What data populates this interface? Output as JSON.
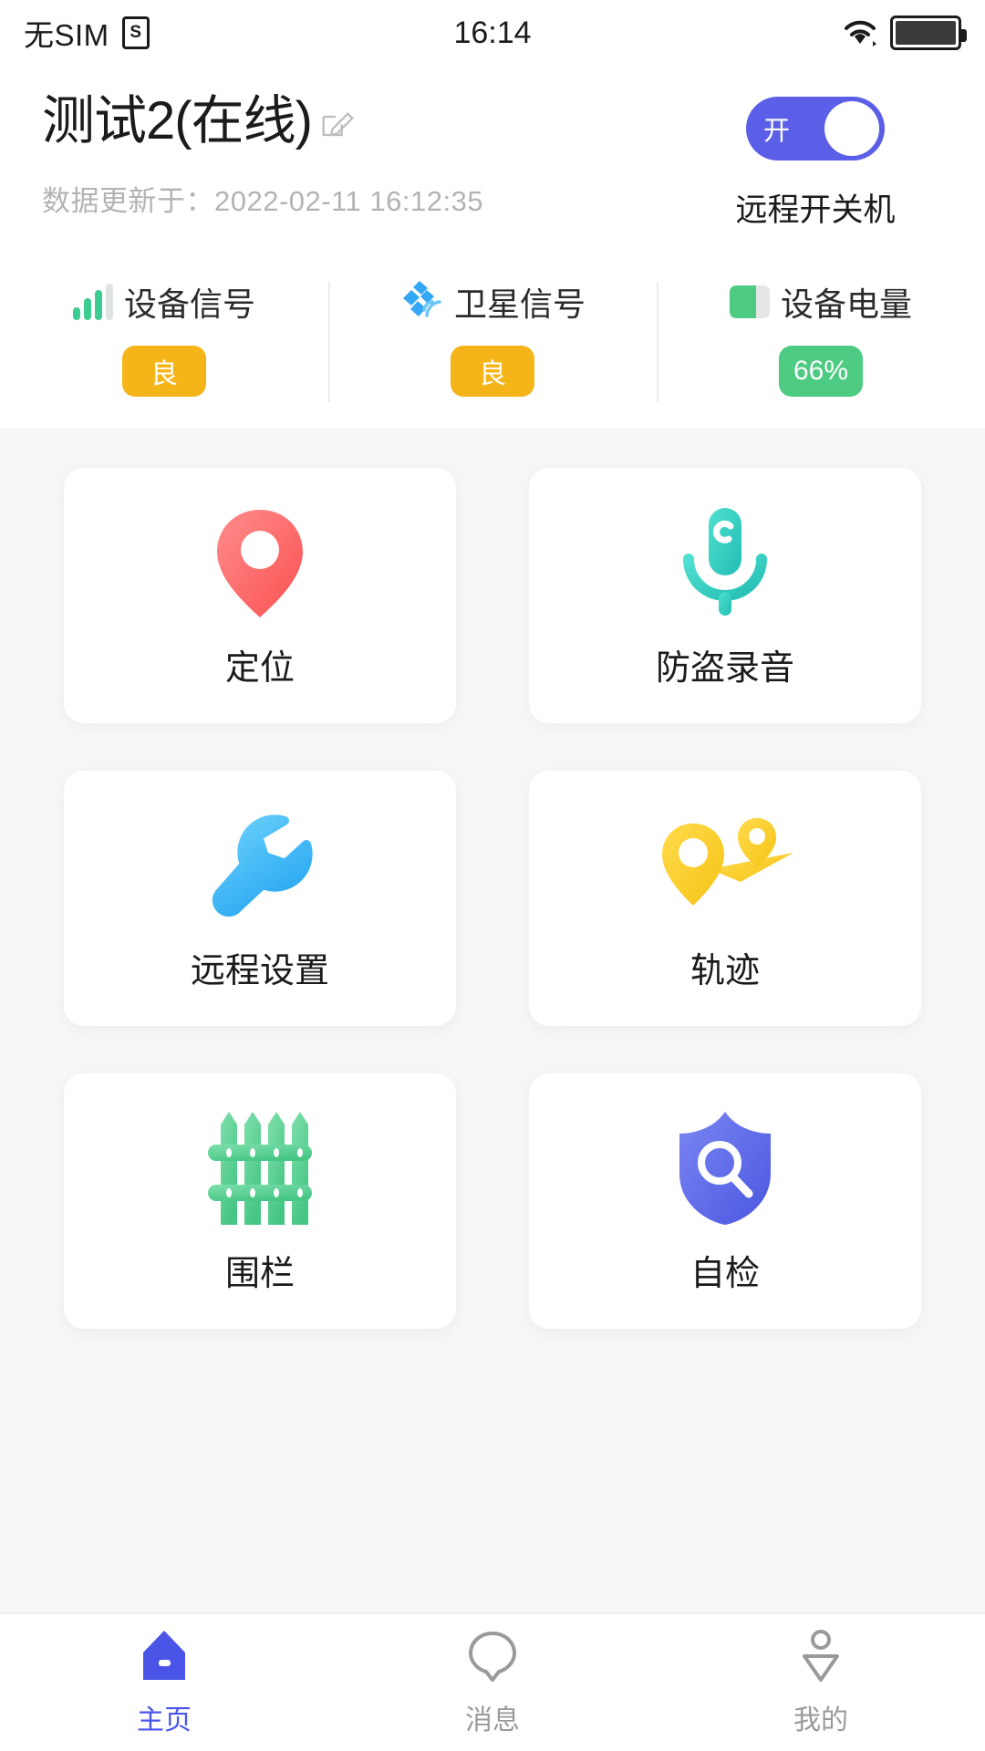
{
  "status_bar": {
    "carrier": "无SIM",
    "sim_icon": "sim-card-icon",
    "time": "16:14",
    "wifi_icon": "wifi-icon",
    "battery_icon": "battery-full-icon"
  },
  "header": {
    "device_name": "测试2(在线)",
    "edit_icon": "edit-pencil-icon",
    "updated_label": "数据更新于：",
    "updated_time": "2022-02-11 16:12:35",
    "power_switch": {
      "state_label": "开",
      "caption": "远程开关机",
      "on": true,
      "on_color": "#5b5fe8"
    }
  },
  "metrics": [
    {
      "icon": "signal-bars-icon",
      "label": "设备信号",
      "value": "良",
      "badge_color": "#f5b519",
      "icon_color": "#3ccb91"
    },
    {
      "icon": "satellite-icon",
      "label": "卫星信号",
      "value": "良",
      "badge_color": "#f5b519",
      "icon_color": "#35a8f5"
    },
    {
      "icon": "battery-icon",
      "label": "设备电量",
      "value": "66%",
      "badge_color": "#4dcb82",
      "icon_color": "#4dcb82",
      "battery_percent": 66
    }
  ],
  "features": [
    {
      "icon": "map-pin-icon",
      "label": "定位",
      "color": "#fb6b6b"
    },
    {
      "icon": "microphone-icon",
      "label": "防盗录音",
      "color": "#35d1c4"
    },
    {
      "icon": "wrench-icon",
      "label": "远程设置",
      "color": "#39b4f5"
    },
    {
      "icon": "route-track-icon",
      "label": "轨迹",
      "color": "#f9cf3c"
    },
    {
      "icon": "fence-icon",
      "label": "围栏",
      "color": "#63d195"
    },
    {
      "icon": "shield-search-icon",
      "label": "自检",
      "color": "#5c6ceb"
    }
  ],
  "tabbar": [
    {
      "icon": "home-icon",
      "label": "主页",
      "active": true,
      "color": "#4a55e8"
    },
    {
      "icon": "message-icon",
      "label": "消息",
      "active": false,
      "color": "#9a9a9a"
    },
    {
      "icon": "person-icon",
      "label": "我的",
      "active": false,
      "color": "#9a9a9a"
    }
  ]
}
